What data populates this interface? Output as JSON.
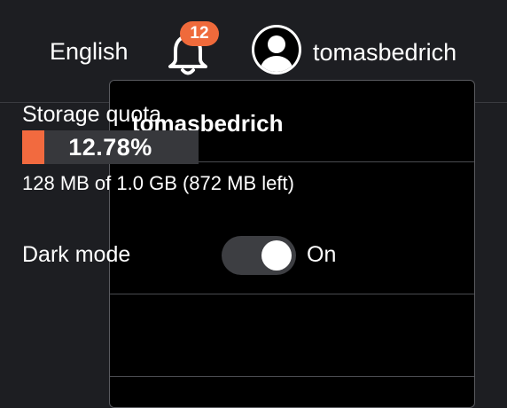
{
  "header": {
    "language": "English",
    "notifications": {
      "count": "12",
      "icon": "bell-icon"
    },
    "user": {
      "username": "tomasbedrich",
      "avatar_icon": "user-avatar-icon"
    }
  },
  "dropdown": {
    "username": "tomasbedrich",
    "storage": {
      "label": "Storage quota",
      "percent_text": "12.78%",
      "used_fraction": 0.1278,
      "detail": "128 MB of 1.0 GB (872 MB left)"
    },
    "dark_mode": {
      "label": "Dark mode",
      "state": "On",
      "enabled": true
    }
  },
  "colors": {
    "accent": "#f26a3f",
    "badge": "#ef6a3b",
    "background": "#1d1e22",
    "dropdown_bg": "#000000"
  }
}
